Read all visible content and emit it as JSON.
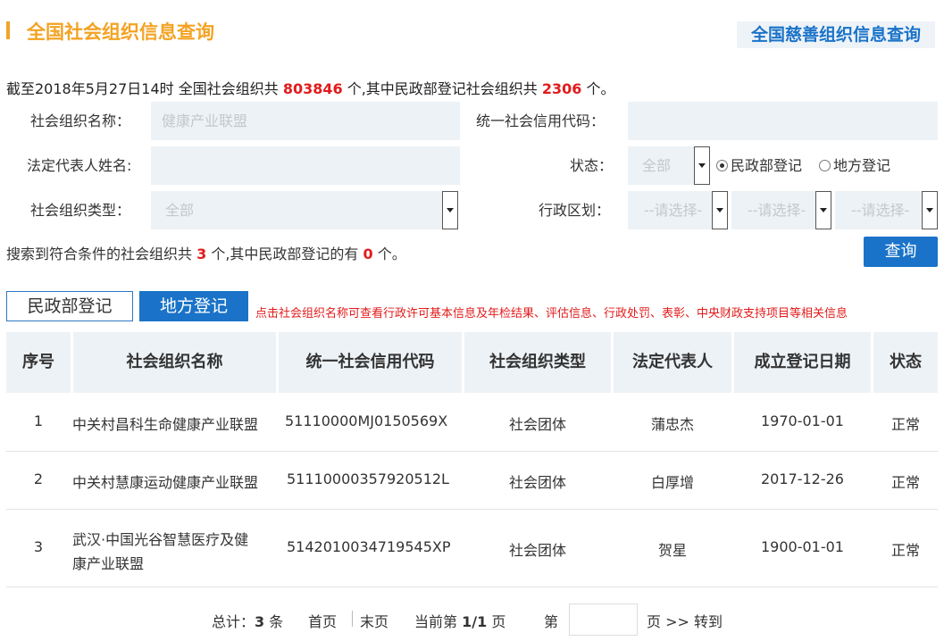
{
  "header": {
    "title": "全国社会组织信息查询",
    "charity_link": "全国慈善组织信息查询"
  },
  "summary": {
    "prefix": "截至2018年5月27日14时 全国社会组织共",
    "total": "803846",
    "middle": "个,其中民政部登记社会组织共",
    "ministry_total": "2306",
    "suffix": "个。"
  },
  "form": {
    "org_name_label": "社会组织名称：",
    "org_name_value": "健康产业联盟",
    "credit_code_label": "统一社会信用代码：",
    "credit_code_value": "",
    "legal_rep_label": "法定代表人姓名:",
    "legal_rep_value": "",
    "status_label": "状态：",
    "status_value": "全部",
    "radio_ministry": "民政部登记",
    "radio_local": "地方登记",
    "type_label": "社会组织类型：",
    "type_value": "全部",
    "region_label": "行政区划：",
    "region_1": "--请选择-",
    "region_2": "--请选择-",
    "region_3": "--请选择-"
  },
  "result": {
    "prefix": "搜索到符合条件的社会组织共",
    "count": "3",
    "middle": "个,其中民政部登记的有",
    "ministry_count": "0",
    "suffix": "个。",
    "query_button": "查询"
  },
  "tabs": {
    "ministry": "民政部登记",
    "local": "地方登记",
    "notice": "点击社会组织名称可查看行政许可基本信息及年检结果、评估信息、行政处罚、表彰、中央财政支持项目等相关信息"
  },
  "table": {
    "headers": [
      "序号",
      "社会组织名称",
      "统一社会信用代码",
      "社会组织类型",
      "法定代表人",
      "成立登记日期",
      "状态"
    ],
    "rows": [
      {
        "index": "1",
        "name": "中关村昌科生命健康产业联盟",
        "code": "51110000MJ0150569X",
        "type": "社会团体",
        "rep": "蒲忠杰",
        "date": "1970-01-01",
        "status": "正常"
      },
      {
        "index": "2",
        "name": "中关村慧康运动健康产业联盟",
        "code": "51110000357920512L",
        "type": "社会团体",
        "rep": "白厚增",
        "date": "2017-12-26",
        "status": "正常"
      },
      {
        "index": "3",
        "name_line1": "武汉·中国光谷智慧医疗及健",
        "name_line2": "康产业联盟",
        "code": "5142010034719545XP",
        "type": "社会团体",
        "rep": "贺星",
        "date": "1900-01-01",
        "status": "正常"
      }
    ]
  },
  "pager": {
    "total_label": "总计：",
    "total_count": "3",
    "total_unit": "条",
    "first": "首页",
    "last": "末页",
    "current_label": "当前第",
    "current": "1/1",
    "current_unit": "页",
    "goto_prefix": "第",
    "goto_suffix": "页 >> 转到"
  }
}
